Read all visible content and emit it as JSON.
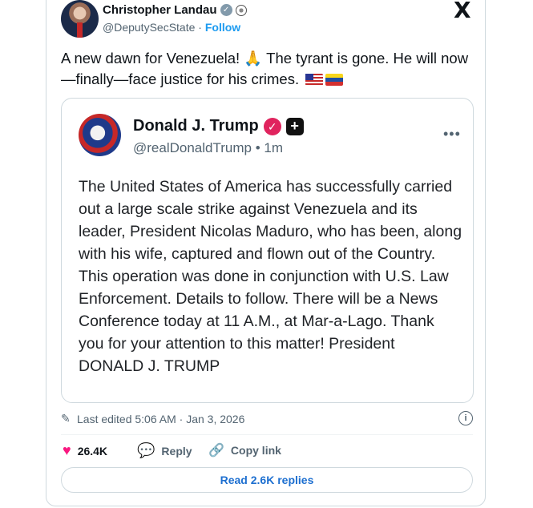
{
  "author": {
    "name": "Christopher Landau",
    "handle": "@DeputySecState",
    "follow_label": "Follow"
  },
  "platform_logo": "X",
  "tweet": {
    "text": "A new dawn for Venezuela! 🙏 The tyrant is gone. He will now—finally—face justice for his crimes."
  },
  "quoted": {
    "name": "Donald J. Trump",
    "handle": "@realDonaldTrump",
    "time": "1m",
    "more": "•••",
    "text": "The United States of America has successfully carried out a large scale strike against Venezuela and its leader, President Nicolas Maduro, who has been, along with his wife, captured and flown out of the Country. This operation was done in conjunction with U.S. Law Enforcement. Details to follow. There will be a News Conference today at 11 A.M., at Mar-a-Lago. Thank you for your attention to this matter! President DONALD J. TRUMP"
  },
  "meta": {
    "edited": "Last edited 5:06 AM · Jan 3, 2026"
  },
  "actions": {
    "likes": "26.4K",
    "reply": "Reply",
    "copy_link": "Copy link"
  },
  "read_replies": "Read 2.6K replies",
  "icons": {
    "verified": "checkmark-badge-icon",
    "seal": "government-seal-icon",
    "flag_us": "us-flag-icon",
    "flag_ve": "venezuela-flag-icon",
    "heart": "heart-icon",
    "reply": "speech-bubble-icon",
    "link": "link-icon",
    "info": "info-icon",
    "pencil": "pencil-icon"
  },
  "colors": {
    "accent": "#1d9bf0",
    "like": "#f91880",
    "muted": "#536471"
  }
}
